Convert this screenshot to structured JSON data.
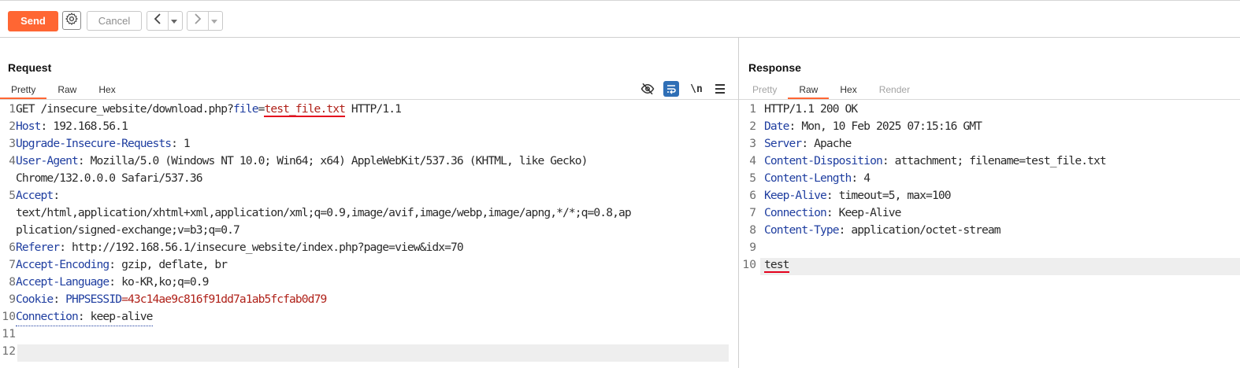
{
  "toolbar": {
    "send_label": "Send",
    "settings_icon": "gear-icon",
    "cancel_label": "Cancel",
    "back_icon": "chevron-left-icon",
    "forward_icon": "chevron-right-icon",
    "dropdown_icon": "chevron-down-icon",
    "accent_color": "#ff6633"
  },
  "request": {
    "title": "Request",
    "tabs": [
      "Pretty",
      "Raw",
      "Hex"
    ],
    "active_tab": "Pretty",
    "icons": [
      "eye-off-icon",
      "wrap-icon",
      "newline-icon",
      "menu-icon"
    ],
    "newline_label": "\\n",
    "lines": [
      {
        "n": "1",
        "method": "GET /insecure_website/download.php?",
        "param": "file",
        "eq": "=",
        "file": "test_file.txt",
        "proto": " HTTP/1.1"
      },
      {
        "n": "2",
        "name": "Host",
        "value": ": 192.168.56.1"
      },
      {
        "n": "3",
        "name": "Upgrade-Insecure-Requests",
        "value": ": 1"
      },
      {
        "n": "4",
        "name": "User-Agent",
        "value": ": Mozilla/5.0 (Windows NT 10.0; Win64; x64) AppleWebKit/537.36 (KHTML, like Gecko)",
        "cont": "Chrome/132.0.0.0 Safari/537.36"
      },
      {
        "n": "5",
        "name": "Accept",
        "value": ":",
        "cont1": "text/html,application/xhtml+xml,application/xml;q=0.9,image/avif,image/webp,image/apng,*/*;q=0.8,ap",
        "cont2": "plication/signed-exchange;v=b3;q=0.7"
      },
      {
        "n": "6",
        "name": "Referer",
        "value": ": http://192.168.56.1/insecure_website/index.php?page=view&idx=70"
      },
      {
        "n": "7",
        "name": "Accept-Encoding",
        "value": ": gzip, deflate, br"
      },
      {
        "n": "8",
        "name": "Accept-Language",
        "value": ": ko-KR,ko;q=0.9"
      },
      {
        "n": "9",
        "name": "Cookie",
        "value": ": ",
        "cookie_name": "PHPSESSID",
        "cookie_eq": "=",
        "cookie_value": "43c14ae9c816f91dd7a1ab5fcfab0d79"
      },
      {
        "n": "10",
        "name": "Connection",
        "value": ": keep-alive"
      },
      {
        "n": "11"
      },
      {
        "n": "12"
      }
    ]
  },
  "response": {
    "title": "Response",
    "tabs": [
      "Pretty",
      "Raw",
      "Hex",
      "Render"
    ],
    "active_tab": "Raw",
    "lines": [
      {
        "n": "1",
        "text": "HTTP/1.1 200 OK"
      },
      {
        "n": "2",
        "name": "Date",
        "value": ": Mon, 10 Feb 2025 07:15:16 GMT"
      },
      {
        "n": "3",
        "name": "Server",
        "value": ": Apache"
      },
      {
        "n": "4",
        "name": "Content-Disposition",
        "value": ": attachment; filename=test_file.txt"
      },
      {
        "n": "5",
        "name": "Content-Length",
        "value": ": 4"
      },
      {
        "n": "6",
        "name": "Keep-Alive",
        "value": ": timeout=5, max=100"
      },
      {
        "n": "7",
        "name": "Connection",
        "value": ": Keep-Alive"
      },
      {
        "n": "8",
        "name": "Content-Type",
        "value": ": application/octet-stream"
      },
      {
        "n": "9"
      },
      {
        "n": "10",
        "body": "test"
      }
    ]
  }
}
